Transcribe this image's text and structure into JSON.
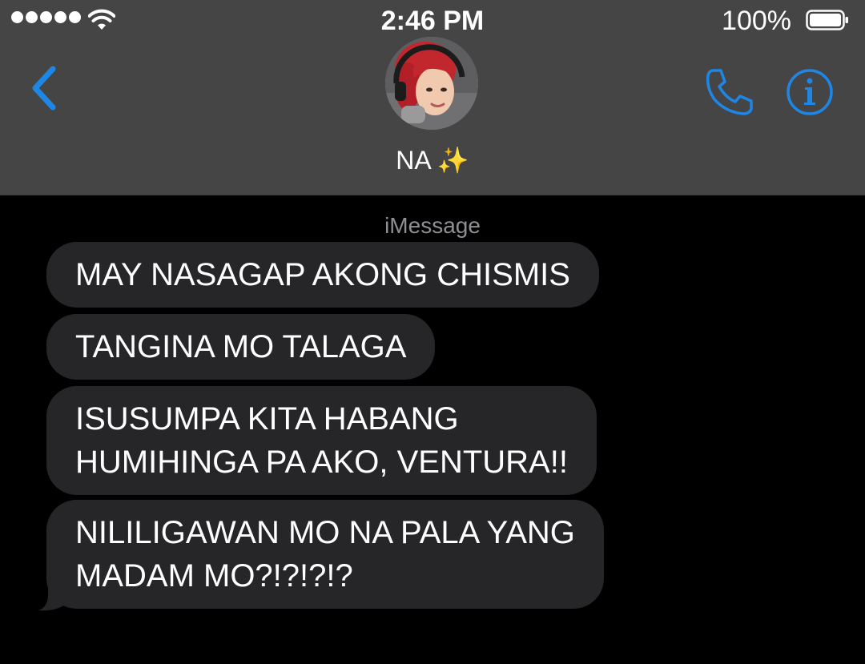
{
  "status_bar": {
    "time": "2:46 PM",
    "battery_percent": "100%",
    "signal_bars": 5,
    "icons": [
      "signal-dots-icon",
      "wifi-icon",
      "battery-icon"
    ]
  },
  "header": {
    "contact_name": "NA ✨",
    "icons": [
      "back-chevron-icon",
      "avatar",
      "phone-icon",
      "info-icon"
    ],
    "accent_color": "#1e87e6",
    "background_color": "#454545"
  },
  "conversation": {
    "service_label": "iMessage",
    "bubble_color": "#262628",
    "messages": [
      {
        "lines": [
          "MAY NASAGAP AKONG CHISMIS"
        ]
      },
      {
        "lines": [
          "TANGINA MO TALAGA"
        ]
      },
      {
        "lines": [
          "ISUSUMPA KITA HABANG",
          "HUMIHINGA PA AKO, VENTURA!!"
        ]
      },
      {
        "lines": [
          "NILILIGAWAN MO NA PALA YANG",
          "MADAM MO?!?!?!?"
        ]
      }
    ]
  }
}
